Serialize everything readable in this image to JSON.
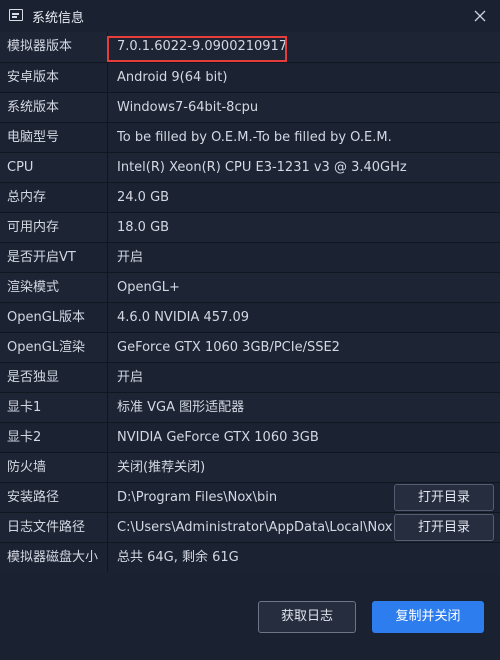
{
  "window": {
    "title": "系统信息"
  },
  "rows": [
    {
      "label": "模拟器版本",
      "value": "7.0.1.6022-9.0900210917"
    },
    {
      "label": "安卓版本",
      "value": "Android 9(64 bit)"
    },
    {
      "label": "系统版本",
      "value": "Windows7-64bit-8cpu"
    },
    {
      "label": "电脑型号",
      "value": "To be filled by O.E.M.-To be filled by O.E.M."
    },
    {
      "label": "CPU",
      "value": "Intel(R) Xeon(R) CPU E3-1231 v3 @ 3.40GHz"
    },
    {
      "label": "总内存",
      "value": "24.0 GB"
    },
    {
      "label": "可用内存",
      "value": "18.0 GB"
    },
    {
      "label": "是否开启VT",
      "value": "开启"
    },
    {
      "label": "渲染模式",
      "value": "OpenGL+"
    },
    {
      "label": "OpenGL版本",
      "value": "4.6.0 NVIDIA 457.09"
    },
    {
      "label": "OpenGL渲染",
      "value": "GeForce GTX 1060 3GB/PCIe/SSE2"
    },
    {
      "label": "是否独显",
      "value": "开启"
    },
    {
      "label": "显卡1",
      "value": "标准 VGA 图形适配器"
    },
    {
      "label": "显卡2",
      "value": "NVIDIA GeForce GTX 1060 3GB"
    },
    {
      "label": "防火墙",
      "value": "关闭(推荐关闭)"
    },
    {
      "label": "安装路径",
      "value": "D:\\Program Files\\Nox\\bin",
      "button": "打开目录"
    },
    {
      "label": "日志文件路径",
      "value": "C:\\Users\\Administrator\\AppData\\Local\\Nox",
      "button": "打开目录"
    },
    {
      "label": "模拟器磁盘大小",
      "value": "总共 64G, 剩余 61G"
    }
  ],
  "buttons": {
    "get_log": "获取日志",
    "copy_close": "复制并关闭"
  },
  "colors": {
    "background": "#1a2131",
    "accent": "#2e7dee",
    "highlight": "#e53c3c"
  }
}
